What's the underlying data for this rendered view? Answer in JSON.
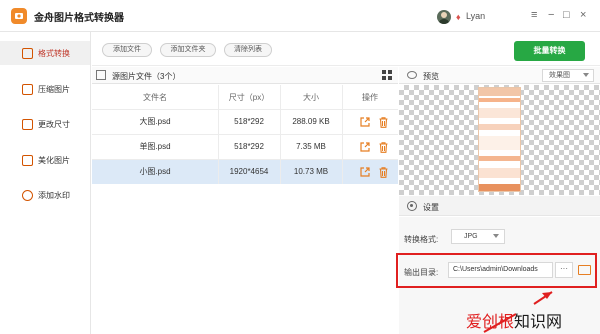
{
  "app": {
    "title": "金舟图片格式转换器",
    "user": "Lyan"
  },
  "window_controls": {
    "menu": "≡",
    "minimize": "−",
    "maximize": "□",
    "close": "×"
  },
  "sidebar": {
    "items": [
      {
        "label": "格式转换",
        "active": true
      },
      {
        "label": "压缩图片",
        "active": false
      },
      {
        "label": "更改尺寸",
        "active": false
      },
      {
        "label": "美化图片",
        "active": false
      },
      {
        "label": "添加水印",
        "active": false
      }
    ]
  },
  "toolbar": {
    "add_file": "添加文件",
    "add_folder": "添加文件夹",
    "clear_list": "清除列表",
    "batch_convert": "批量转换"
  },
  "file_list": {
    "title": "源图片文件（3个）",
    "columns": [
      "文件名",
      "尺寸（px）",
      "大小",
      "操作"
    ],
    "rows": [
      {
        "name": "大图.psd",
        "size_px": "518*292",
        "file_size": "288.09 KB",
        "selected": false
      },
      {
        "name": "单图.psd",
        "size_px": "518*292",
        "file_size": "7.35 MB",
        "selected": false
      },
      {
        "name": "小图.psd",
        "size_px": "1920*4654",
        "file_size": "10.73 MB",
        "selected": true
      }
    ]
  },
  "preview": {
    "title": "预览",
    "mode": "效果图"
  },
  "settings": {
    "title": "设置",
    "format_label": "转换格式:",
    "format_value": "JPG",
    "output_label": "输出目录:",
    "output_value": "C:\\Users\\admin\\Downloads",
    "more": "···"
  },
  "watermark": {
    "red_part": "爱创根",
    "rest": "知识网"
  },
  "colors": {
    "accent": "#e67e22",
    "batch_button": "#27a844",
    "highlight": "#e02020",
    "selected_row": "#dce9f7"
  }
}
